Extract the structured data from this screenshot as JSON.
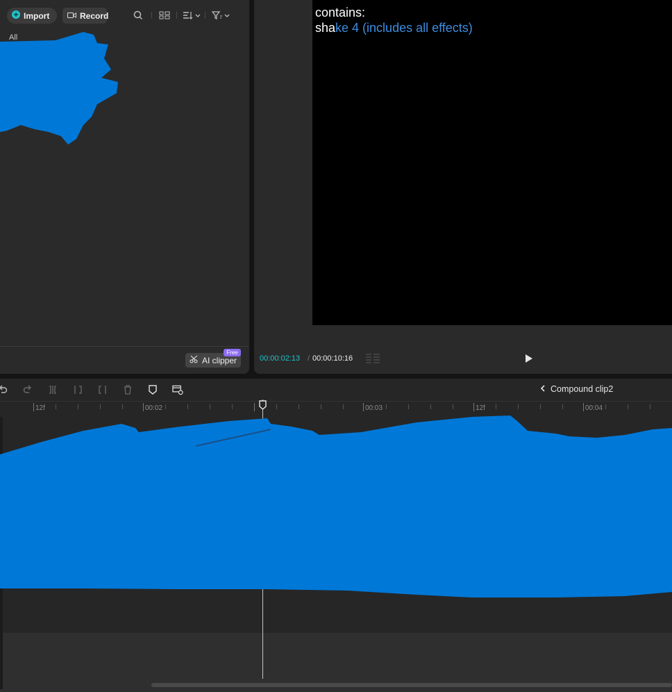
{
  "media_panel": {
    "import_label": "Import",
    "record_label": "Record",
    "filter_all_label": "All",
    "ai_clipper_label": "AI clipper",
    "free_badge": "Free"
  },
  "player": {
    "preview_line1": "contains:",
    "preview_line2_white": "sha",
    "preview_line2_blue": "ke 4 (includes all effects)",
    "timecode_current": "00:00:02:13",
    "timecode_separator": "/",
    "timecode_total": "00:00:10:16"
  },
  "timeline": {
    "breadcrumb_label": "Compound clip2",
    "ruler_labels": [
      "12f",
      "00:02",
      "00:03",
      "12f",
      "00:04"
    ]
  },
  "colors": {
    "accent": "#1fc3c8",
    "scribble": "#0078d7",
    "badge": "#8d6cf0"
  }
}
